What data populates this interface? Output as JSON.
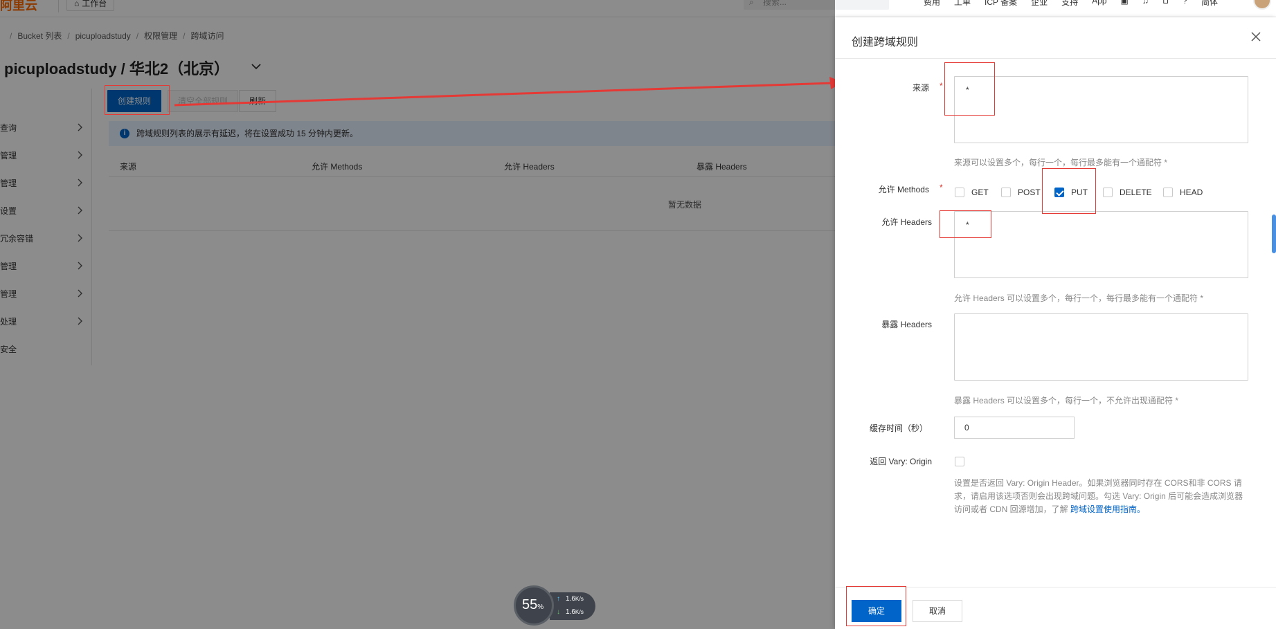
{
  "topbar": {
    "logo": "阿里云",
    "workbench": "工作台",
    "search_placeholder": "搜索...",
    "nav": [
      "费用",
      "工单",
      "ICP 备案",
      "企业",
      "支持",
      "App"
    ],
    "lang": "简体"
  },
  "breadcrumb": [
    "Bucket 列表",
    "picuploadstudy",
    "权限管理",
    "跨域访问"
  ],
  "page_title": "picuploadstudy / 华北2（北京）",
  "leftnav": [
    "查询",
    "管理",
    "管理",
    "设置",
    "冗余容错",
    "管理",
    "管理",
    "处理",
    "安全"
  ],
  "toolbar": {
    "create": "创建规则",
    "clear": "清空全部规则",
    "refresh": "刷新"
  },
  "notice": "跨域规则列表的展示有延迟，将在设置成功 15 分钟内更新。",
  "table": {
    "headers": [
      "来源",
      "允许 Methods",
      "允许 Headers",
      "暴露 Headers"
    ],
    "empty": "暂无数据"
  },
  "drawer": {
    "title": "创建跨域规则",
    "origin_label": "来源",
    "origin_value": "*",
    "origin_hint": "来源可以设置多个，每行一个，每行最多能有一个通配符 *",
    "methods_label": "允许 Methods",
    "methods": [
      {
        "label": "GET",
        "checked": false
      },
      {
        "label": "POST",
        "checked": false
      },
      {
        "label": "PUT",
        "checked": true
      },
      {
        "label": "DELETE",
        "checked": false
      },
      {
        "label": "HEAD",
        "checked": false
      }
    ],
    "allow_headers_label": "允许 Headers",
    "allow_headers_value": "*",
    "allow_headers_hint": "允许 Headers 可以设置多个，每行一个，每行最多能有一个通配符 *",
    "expose_headers_label": "暴露 Headers",
    "expose_headers_value": "",
    "expose_headers_hint": "暴露 Headers 可以设置多个，每行一个，不允许出现通配符 *",
    "cache_label": "缓存时间（秒）",
    "cache_value": "0",
    "vary_label": "返回 Vary: Origin",
    "vary_desc": "设置是否返回 Vary: Origin Header。如果浏览器同时存在 CORS和非 CORS 请求，请启用该选项否则会出现跨域问题。勾选 Vary: Origin 后可能会造成浏览器访问或者 CDN 回源增加，了解 ",
    "vary_link": "跨域设置使用指南。",
    "ok": "确定",
    "cancel": "取消"
  },
  "net_widget": {
    "percent": "55",
    "percent_unit": "%",
    "up": "1.6",
    "down": "1.6",
    "unit": "K/s"
  },
  "colors": {
    "primary": "#0064c8",
    "annotation": "#e53935",
    "logo": "#ff6a00"
  }
}
